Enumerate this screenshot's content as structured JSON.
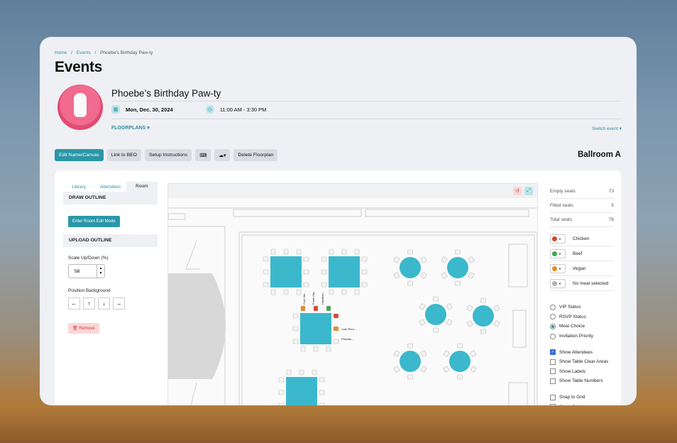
{
  "breadcrumb": {
    "home": "Home",
    "events": "Events",
    "current": "Phoebe's Birthday Paw-ty",
    "sep": "/"
  },
  "page_title": "Events",
  "event": {
    "name": "Phoebe’s Birthday Paw-ty",
    "date": "Mon, Dec. 30, 2024",
    "time": "11:00 AM - 3:30 PM",
    "floorplans_label": "FLOORPLANS",
    "switch_label": "Switch event"
  },
  "toolbar": {
    "edit": "Edit Name/Canvas",
    "link": "Link to BEO",
    "setup": "Setup Instructions",
    "delete": "Delete Floorplan",
    "room_name": "Ballroom A"
  },
  "left_panel": {
    "tabs": [
      "Library",
      "Attendees",
      "Room"
    ],
    "draw_outline": "DRAW OUTLINE",
    "enter_room": "Enter Room Edit Mode",
    "upload_outline": "UPLOAD OUTLINE",
    "scale_label": "Scale Up/Down (%)",
    "scale_value": "58",
    "position_label": "Position Background",
    "arrows": [
      "←",
      "↑",
      "↓",
      "→"
    ],
    "remove": "Remove"
  },
  "canvas": {
    "labels": {
      "top1": "Cole We...",
      "top2": "Frank Ma...",
      "top3": "Hamilton...",
      "side1": "Cole Rem...",
      "side2": "Priscilla..."
    }
  },
  "stats": [
    {
      "label": "Empty seats",
      "value": "73"
    },
    {
      "label": "Filled seats",
      "value": "5"
    },
    {
      "label": "Total seats",
      "value": "78"
    }
  ],
  "meals": [
    {
      "label": "Chicken",
      "color": "#d9452b"
    },
    {
      "label": "Beef",
      "color": "#3aa854"
    },
    {
      "label": "Vegan",
      "color": "#e88a1c"
    },
    {
      "label": "No meal selected",
      "color": "#b0b0b0"
    }
  ],
  "colors": {
    "accent": "#2a97a8",
    "table": "#3bb8cc",
    "chair": "#dddddd"
  },
  "color_by": [
    {
      "label": "VIP Status",
      "checked": false
    },
    {
      "label": "RSVP Status",
      "checked": false
    },
    {
      "label": "Meal Choice",
      "checked": true
    },
    {
      "label": "Invitation Priority",
      "checked": false
    }
  ],
  "show": [
    {
      "label": "Show Attendees",
      "checked": true
    },
    {
      "label": "Show Table Clear Areas",
      "checked": false
    },
    {
      "label": "Show Labels",
      "checked": false
    },
    {
      "label": "Show Table Numbers",
      "checked": false
    }
  ],
  "grid": [
    {
      "label": "Snap to Grid",
      "checked": false
    },
    {
      "label": "Show Grid",
      "checked": false
    }
  ]
}
